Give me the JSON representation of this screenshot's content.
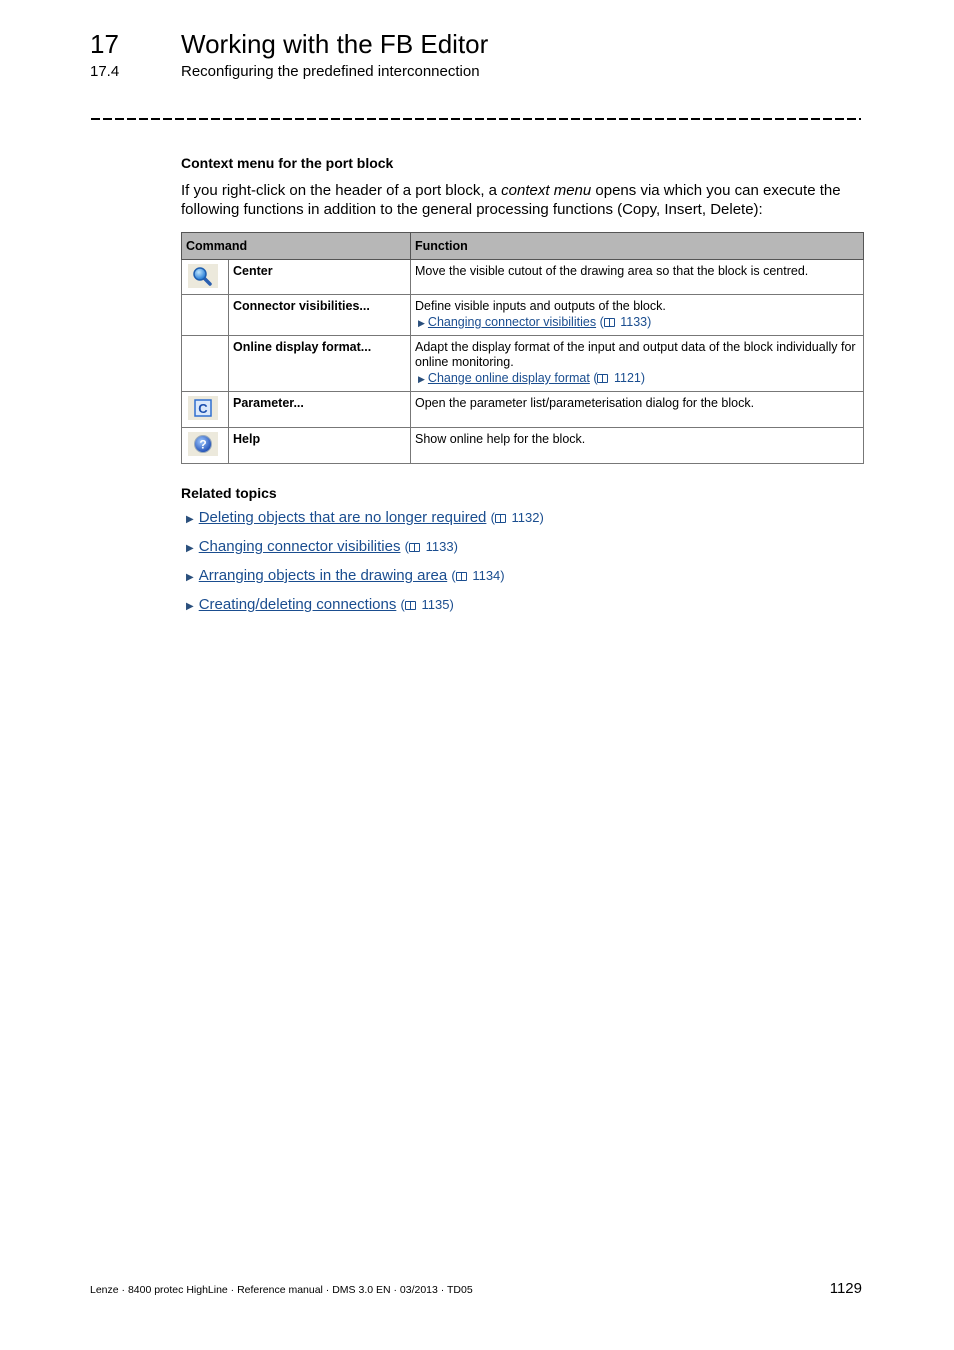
{
  "header": {
    "chapter_number": "17",
    "chapter_title": "Working with the FB Editor",
    "section_number": "17.4",
    "section_title": "Reconfiguring the predefined interconnection"
  },
  "content": {
    "subheading": "Context menu for the port block",
    "intro_before": "If you right-click on the header of a port block, a ",
    "intro_emphasis": "context menu",
    "intro_after": " opens via which you can execute the following functions in addition to the general processing functions (Copy, Insert, Delete):",
    "table": {
      "headers": [
        "Command",
        "Function"
      ],
      "rows": [
        {
          "icon": "magnifier-icon",
          "command": "Center",
          "function": "Move the visible cutout of the drawing area so that the block is centred.",
          "link": null
        },
        {
          "icon": null,
          "command": "Connector visibilities...",
          "function": "Define visible inputs and outputs of the block.",
          "link": {
            "text": "Changing connector visibilities",
            "page": "1133"
          }
        },
        {
          "icon": null,
          "command": "Online display format...",
          "function": "Adapt the display format of the input and output data of the block individually for online monitoring.",
          "link": {
            "text": "Change online display format",
            "page": "1121"
          }
        },
        {
          "icon": "parameter-c-icon",
          "command": "Parameter...",
          "function": "Open the parameter list/parameterisation dialog for the block.",
          "link": null
        },
        {
          "icon": "help-icon",
          "command": "Help",
          "function": "Show online help for the block.",
          "link": null
        }
      ]
    },
    "related_heading": "Related topics",
    "related": [
      {
        "text": "Deleting objects that are no longer required",
        "page": "1132"
      },
      {
        "text": "Changing connector visibilities",
        "page": "1133"
      },
      {
        "text": "Arranging objects in the drawing area",
        "page": "1134"
      },
      {
        "text": "Creating/deleting connections",
        "page": "1135"
      }
    ]
  },
  "footer": {
    "left": "Lenze · 8400 protec HighLine · Reference manual · DMS 3.0 EN · 03/2013 · TD05",
    "page_number": "1129"
  },
  "colors": {
    "link": "#1a4d8f",
    "table_header_bg": "#b7b7b7"
  }
}
